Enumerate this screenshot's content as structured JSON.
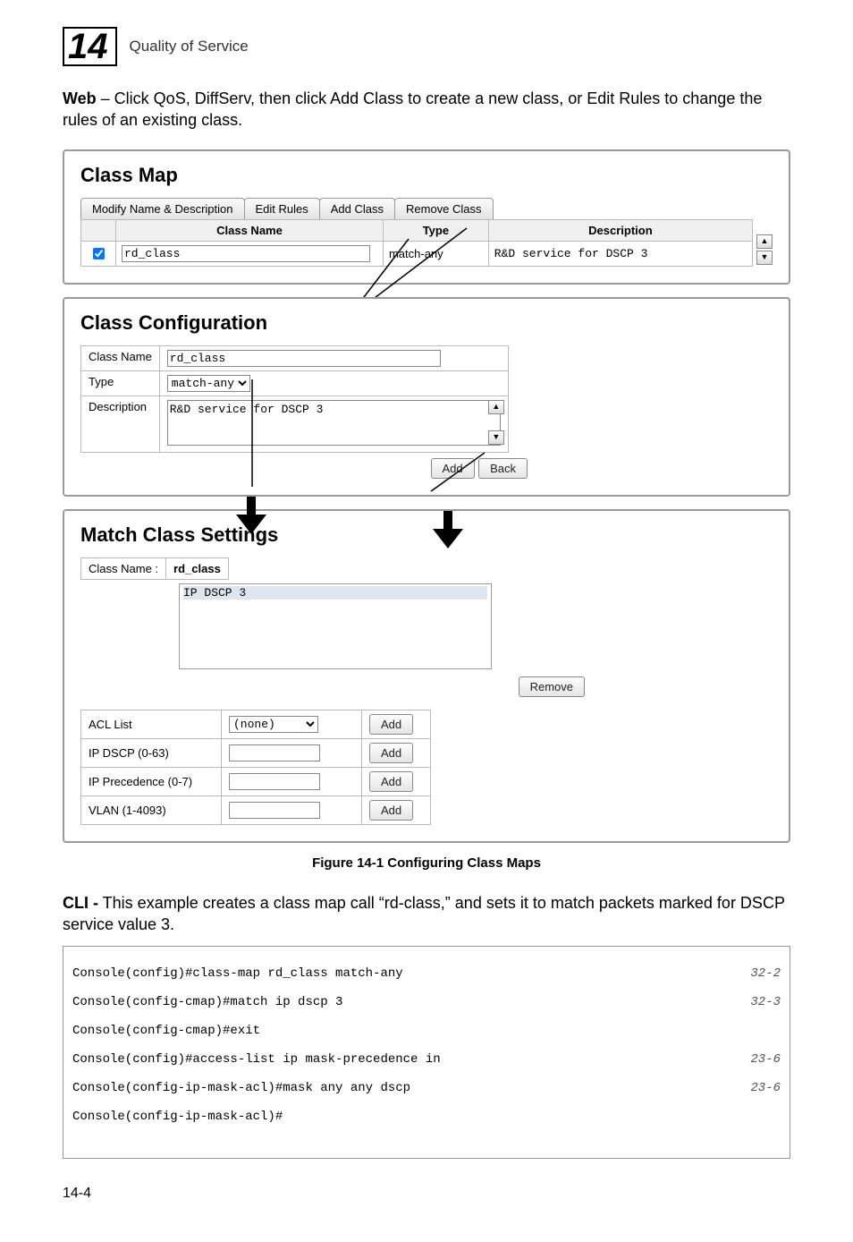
{
  "chapter": {
    "number": "14",
    "title": "Quality of Service"
  },
  "intro": {
    "bold": "Web",
    "text": " – Click QoS, DiffServ, then click Add Class to create a new class, or Edit Rules to change the rules of an existing class."
  },
  "classMap": {
    "heading": "Class Map",
    "tabs": [
      "Modify Name & Description",
      "Edit Rules",
      "Add Class",
      "Remove Class"
    ],
    "headers": {
      "name": "Class Name",
      "type": "Type",
      "desc": "Description"
    },
    "row": {
      "name": "rd_class",
      "type": "match-any",
      "desc": "R&D service for DSCP 3"
    }
  },
  "classConfig": {
    "heading": "Class Configuration",
    "labels": {
      "name": "Class Name",
      "type": "Type",
      "desc": "Description"
    },
    "values": {
      "name": "rd_class",
      "type": "match-any",
      "desc": "R&D service for DSCP 3"
    },
    "buttons": {
      "add": "Add",
      "back": "Back"
    }
  },
  "matchSettings": {
    "heading": "Match Class Settings",
    "className": {
      "label": "Class Name :",
      "value": "rd_class"
    },
    "ruleListItem": "IP DSCP 3",
    "removeBtn": "Remove",
    "rows": {
      "acl": {
        "label": "ACL List",
        "option": "(none)"
      },
      "dscp": {
        "label": "IP DSCP (0-63)"
      },
      "prec": {
        "label": "IP Precedence (0-7)"
      },
      "vlan": {
        "label": "VLAN (1-4093)"
      }
    },
    "addBtn": "Add"
  },
  "figureCaption": "Figure 14-1   Configuring Class Maps",
  "cliIntro": {
    "bold": "CLI -",
    "text": " This example creates a class map call “rd-class,” and sets it to match packets marked for DSCP service value 3."
  },
  "console": [
    {
      "text": "Console(config)#class-map rd_class match-any",
      "ref": "32-2"
    },
    {
      "text": "Console(config-cmap)#match ip dscp 3",
      "ref": "32-3"
    },
    {
      "text": "Console(config-cmap)#exit",
      "ref": ""
    },
    {
      "text": "Console(config)#access-list ip mask-precedence in",
      "ref": "23-6"
    },
    {
      "text": "Console(config-ip-mask-acl)#mask any any dscp",
      "ref": "23-6"
    },
    {
      "text": "Console(config-ip-mask-acl)#",
      "ref": ""
    }
  ],
  "pageNumber": "14-4"
}
